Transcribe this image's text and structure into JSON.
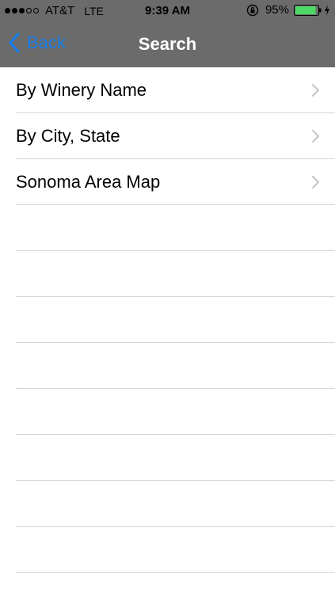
{
  "status_bar": {
    "signal_dots_filled": 3,
    "signal_dots_total": 5,
    "carrier": "AT&T",
    "network": "LTE",
    "time": "9:39 AM",
    "battery_percent": "95%",
    "battery_level": 0.95,
    "battery_color": "#4cd964"
  },
  "nav": {
    "back_label": "Back",
    "title": "Search",
    "accent_color": "#1a7ee6"
  },
  "menu": {
    "items": [
      {
        "label": "By Winery Name",
        "icon": "chevron-right-icon"
      },
      {
        "label": "By City, State",
        "icon": "chevron-right-icon"
      },
      {
        "label": "Sonoma Area Map",
        "icon": "chevron-right-icon"
      }
    ],
    "empty_rows": 8
  }
}
